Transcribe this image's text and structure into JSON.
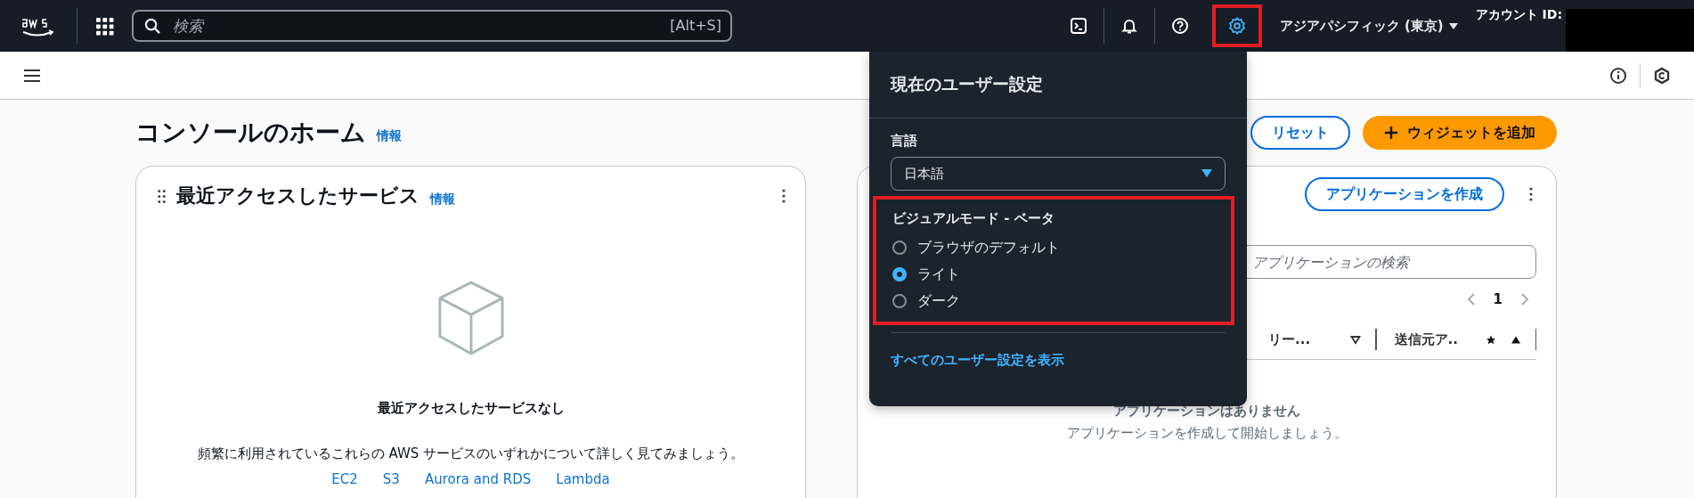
{
  "top_nav": {
    "search": {
      "placeholder": "検索",
      "shortcut": "[Alt+S]"
    },
    "settings_highlighted": true,
    "region": "アジアパシフィック (東京)",
    "account_label": "アカウント ID:"
  },
  "page": {
    "title": "コンソールのホーム",
    "info_link": "情報",
    "reset_button": "リセット",
    "add_widget_button": "ウィジェットを追加"
  },
  "recent_services": {
    "title": "最近アクセスしたサービス",
    "info_link": "情報",
    "empty_title": "最近アクセスしたサービスなし",
    "empty_text": "頻繁に利用されているこれらの AWS サービスのいずれかについて詳しく見てみましょう。",
    "links": [
      "EC2",
      "S3",
      "Aurora and RDS",
      "Lambda"
    ]
  },
  "applications": {
    "create_button": "アプリケーションを作成",
    "search": {
      "placeholder": "アプリケーションの検索"
    },
    "page": "1",
    "columns": [
      "リー...",
      "送信元ア.."
    ],
    "empty_title": "アプリケーションはありません",
    "empty_text": "アプリケーションを作成して開始しましょう。"
  },
  "settings_menu": {
    "title": "現在のユーザー設定",
    "language_label": "言語",
    "language_value": "日本語",
    "visual_mode": {
      "label": "ビジュアルモード - ベータ",
      "highlighted": true,
      "options": [
        {
          "label": "ブラウザのデフォルト",
          "selected": false
        },
        {
          "label": "ライト",
          "selected": true
        },
        {
          "label": "ダーク",
          "selected": false
        }
      ]
    },
    "footer_link": "すべてのユーザー設定を表示"
  }
}
